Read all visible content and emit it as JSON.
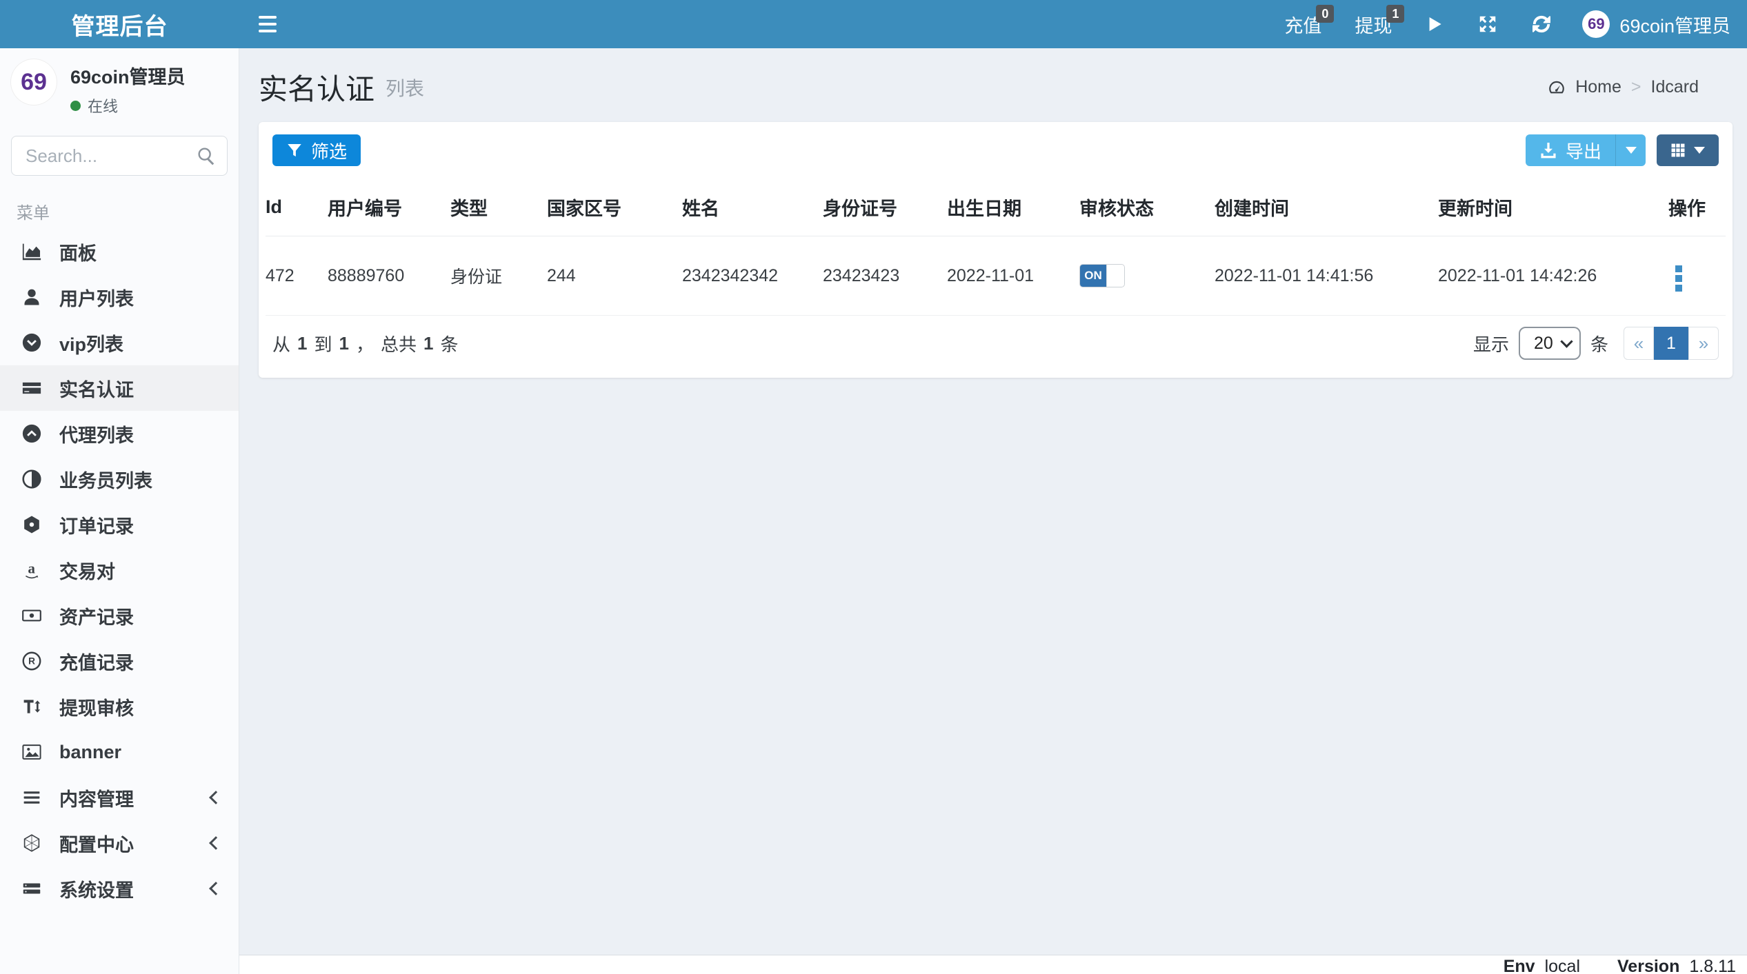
{
  "colors": {
    "navbar_blue": "#3c8dbc",
    "filter_button_blue": "#0d87da",
    "export_button_blue": "#54b7ea",
    "grid_button_dark_blue": "#3a668e",
    "toggle_on_blue": "#3273b0",
    "active_page_blue": "#3273b0",
    "logo_purple": "#5c3191",
    "online_green": "#2f8f46",
    "badge_gray": "#50565c"
  },
  "navbar": {
    "brand": "管理后台",
    "recharge": {
      "label": "充值",
      "badge": "0"
    },
    "withdraw": {
      "label": "提现",
      "badge": "1"
    },
    "username": "69coin管理员",
    "logo_text": "69"
  },
  "sidebar": {
    "user": {
      "name": "69coin管理员",
      "status": "在线"
    },
    "search_placeholder": "Search...",
    "menu_label": "菜单",
    "items": [
      {
        "label": "面板"
      },
      {
        "label": "用户列表"
      },
      {
        "label": "vip列表"
      },
      {
        "label": "实名认证"
      },
      {
        "label": "代理列表"
      },
      {
        "label": "业务员列表"
      },
      {
        "label": "订单记录"
      },
      {
        "label": "交易对"
      },
      {
        "label": "资产记录"
      },
      {
        "label": "充值记录"
      },
      {
        "label": "提现审核"
      },
      {
        "label": "banner"
      },
      {
        "label": "内容管理"
      },
      {
        "label": "配置中心"
      },
      {
        "label": "系统设置"
      }
    ]
  },
  "page": {
    "title": "实名认证",
    "subtitle": "列表",
    "breadcrumb": {
      "home": "Home",
      "current": "Idcard"
    }
  },
  "toolbar": {
    "filter_label": "筛选",
    "export_label": "导出"
  },
  "table": {
    "columns": [
      "Id",
      "用户编号",
      "类型",
      "国家区号",
      "姓名",
      "身份证号",
      "出生日期",
      "审核状态",
      "创建时间",
      "更新时间",
      "操作"
    ],
    "rows": [
      {
        "id": "472",
        "user_no": "88889760",
        "type": "身份证",
        "country_code": "244",
        "name": "2342342342",
        "id_number": "23423423",
        "birth_date": "2022-11-01",
        "status": "ON",
        "created_at": "2022-11-01 14:41:56",
        "updated_at": "2022-11-01 14:42:26"
      }
    ]
  },
  "pagination": {
    "info": {
      "from_label": "从",
      "from": "1",
      "to_label": "到",
      "to": "1",
      "comma": "，",
      "total_label": "总共",
      "total": "1",
      "unit": "条"
    },
    "show_label": "显示",
    "page_size": "20",
    "unit_label": "条",
    "prev": "«",
    "page": "1",
    "next": "»"
  },
  "footer": {
    "env_label": "Env",
    "env_value": "local",
    "version_label": "Version",
    "version_value": "1.8.11"
  }
}
